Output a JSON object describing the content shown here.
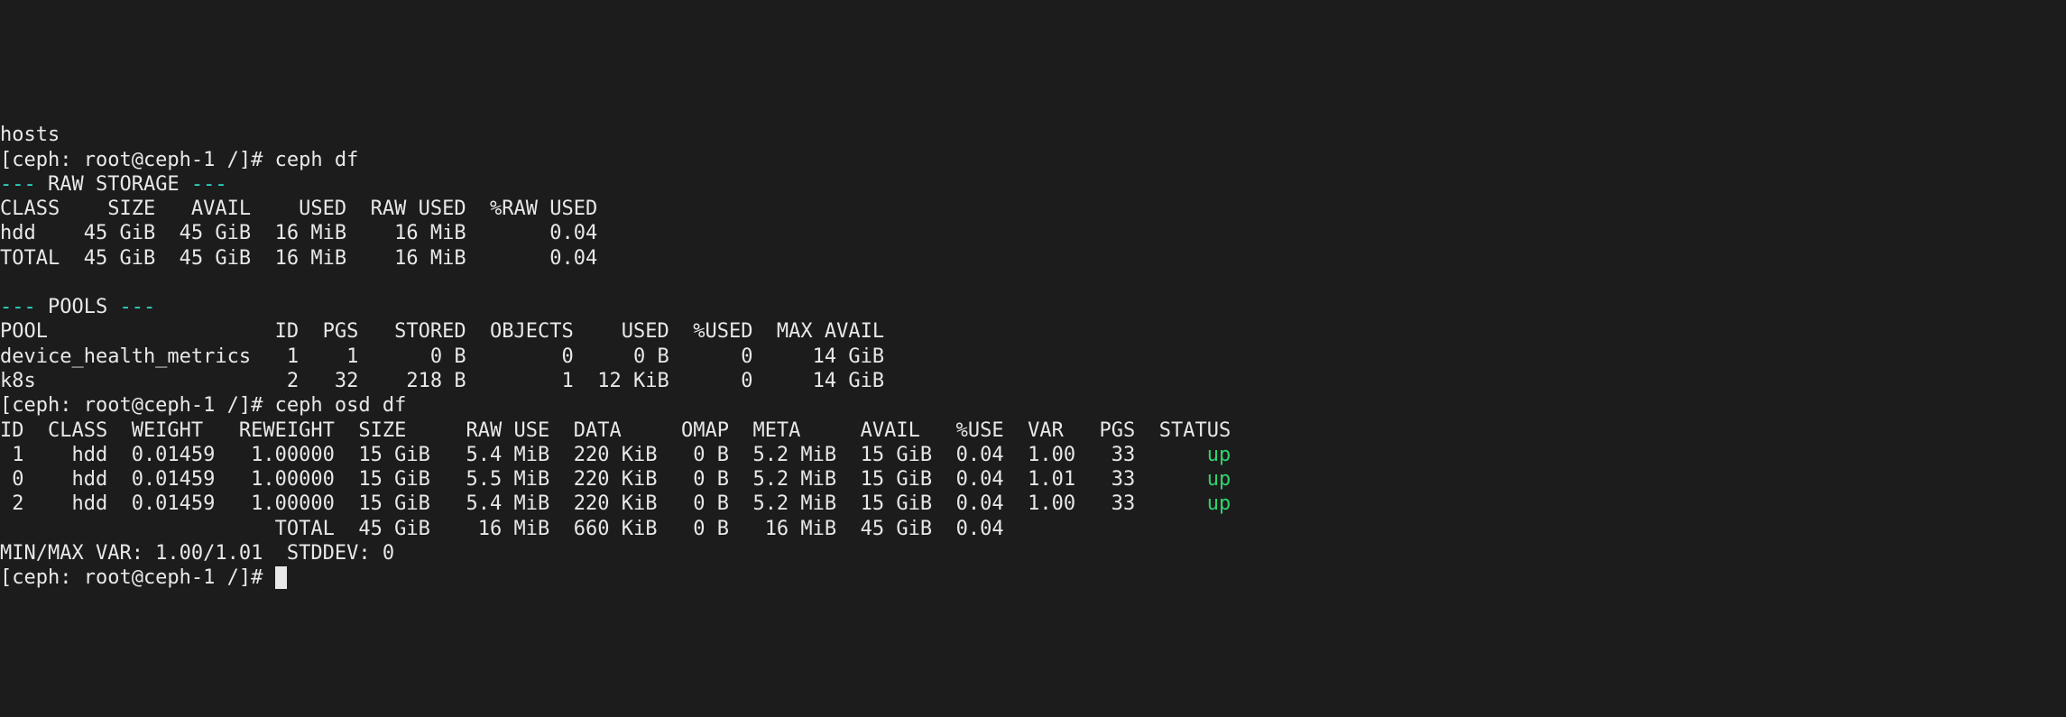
{
  "lines": {
    "l0": "hosts",
    "prompt1_prefix": "[ceph: root@ceph-1 /]# ",
    "cmd1": "ceph df",
    "raw_hdr_dashes": "--- ",
    "raw_hdr_label": "RAW STORAGE",
    "raw_hdr_trail": " ---",
    "raw_cols": "CLASS    SIZE   AVAIL    USED  RAW USED  %RAW USED",
    "raw_row_hdd": "hdd    45 GiB  45 GiB  16 MiB    16 MiB       0.04",
    "raw_row_total": "TOTAL  45 GiB  45 GiB  16 MiB    16 MiB       0.04",
    "blank": " ",
    "pools_hdr_dashes": "--- ",
    "pools_hdr_label": "POOLS",
    "pools_hdr_trail": " ---",
    "pools_cols": "POOL                   ID  PGS   STORED  OBJECTS    USED  %USED  MAX AVAIL",
    "pool_row_dhm": "device_health_metrics   1    1      0 B        0     0 B      0     14 GiB",
    "pool_row_k8s": "k8s                     2   32    218 B        1  12 KiB      0     14 GiB",
    "prompt2_prefix": "[ceph: root@ceph-1 /]# ",
    "cmd2": "ceph osd df",
    "osd_cols": "ID  CLASS  WEIGHT   REWEIGHT  SIZE     RAW USE  DATA     OMAP  META     AVAIL   %USE  VAR   PGS  STATUS",
    "osd_row1_body": " 1    hdd  0.01459   1.00000  15 GiB   5.4 MiB  220 KiB   0 B  5.2 MiB  15 GiB  0.04  1.00   33      ",
    "osd_row1_status": "up",
    "osd_row2_body": " 0    hdd  0.01459   1.00000  15 GiB   5.5 MiB  220 KiB   0 B  5.2 MiB  15 GiB  0.04  1.01   33      ",
    "osd_row2_status": "up",
    "osd_row3_body": " 2    hdd  0.01459   1.00000  15 GiB   5.4 MiB  220 KiB   0 B  5.2 MiB  15 GiB  0.04  1.00   33      ",
    "osd_row3_status": "up",
    "osd_total": "                       TOTAL  45 GiB    16 MiB  660 KiB   0 B   16 MiB  45 GiB  0.04                   ",
    "osd_minmax": "MIN/MAX VAR: 1.00/1.01  STDDEV: 0",
    "prompt3_prefix": "[ceph: root@ceph-1 /]# "
  },
  "raw_storage_table_data": {
    "columns": [
      "CLASS",
      "SIZE",
      "AVAIL",
      "USED",
      "RAW USED",
      "%RAW USED"
    ],
    "rows": [
      {
        "CLASS": "hdd",
        "SIZE": "45 GiB",
        "AVAIL": "45 GiB",
        "USED": "16 MiB",
        "RAW USED": "16 MiB",
        "%RAW USED": "0.04"
      },
      {
        "CLASS": "TOTAL",
        "SIZE": "45 GiB",
        "AVAIL": "45 GiB",
        "USED": "16 MiB",
        "RAW USED": "16 MiB",
        "%RAW USED": "0.04"
      }
    ]
  },
  "pools_table_data": {
    "columns": [
      "POOL",
      "ID",
      "PGS",
      "STORED",
      "OBJECTS",
      "USED",
      "%USED",
      "MAX AVAIL"
    ],
    "rows": [
      {
        "POOL": "device_health_metrics",
        "ID": 1,
        "PGS": 1,
        "STORED": "0 B",
        "OBJECTS": 0,
        "USED": "0 B",
        "%USED": 0,
        "MAX AVAIL": "14 GiB"
      },
      {
        "POOL": "k8s",
        "ID": 2,
        "PGS": 32,
        "STORED": "218 B",
        "OBJECTS": 1,
        "USED": "12 KiB",
        "%USED": 0,
        "MAX AVAIL": "14 GiB"
      }
    ]
  },
  "osd_df_table_data": {
    "columns": [
      "ID",
      "CLASS",
      "WEIGHT",
      "REWEIGHT",
      "SIZE",
      "RAW USE",
      "DATA",
      "OMAP",
      "META",
      "AVAIL",
      "%USE",
      "VAR",
      "PGS",
      "STATUS"
    ],
    "rows": [
      {
        "ID": 1,
        "CLASS": "hdd",
        "WEIGHT": "0.01459",
        "REWEIGHT": "1.00000",
        "SIZE": "15 GiB",
        "RAW USE": "5.4 MiB",
        "DATA": "220 KiB",
        "OMAP": "0 B",
        "META": "5.2 MiB",
        "AVAIL": "15 GiB",
        "%USE": "0.04",
        "VAR": "1.00",
        "PGS": 33,
        "STATUS": "up"
      },
      {
        "ID": 0,
        "CLASS": "hdd",
        "WEIGHT": "0.01459",
        "REWEIGHT": "1.00000",
        "SIZE": "15 GiB",
        "RAW USE": "5.5 MiB",
        "DATA": "220 KiB",
        "OMAP": "0 B",
        "META": "5.2 MiB",
        "AVAIL": "15 GiB",
        "%USE": "0.04",
        "VAR": "1.01",
        "PGS": 33,
        "STATUS": "up"
      },
      {
        "ID": 2,
        "CLASS": "hdd",
        "WEIGHT": "0.01459",
        "REWEIGHT": "1.00000",
        "SIZE": "15 GiB",
        "RAW USE": "5.4 MiB",
        "DATA": "220 KiB",
        "OMAP": "0 B",
        "META": "5.2 MiB",
        "AVAIL": "15 GiB",
        "%USE": "0.04",
        "VAR": "1.00",
        "PGS": 33,
        "STATUS": "up"
      }
    ],
    "total": {
      "SIZE": "45 GiB",
      "RAW USE": "16 MiB",
      "DATA": "660 KiB",
      "OMAP": "0 B",
      "META": "16 MiB",
      "AVAIL": "45 GiB",
      "%USE": "0.04"
    },
    "min_max_var": "1.00/1.01",
    "stddev": 0
  }
}
